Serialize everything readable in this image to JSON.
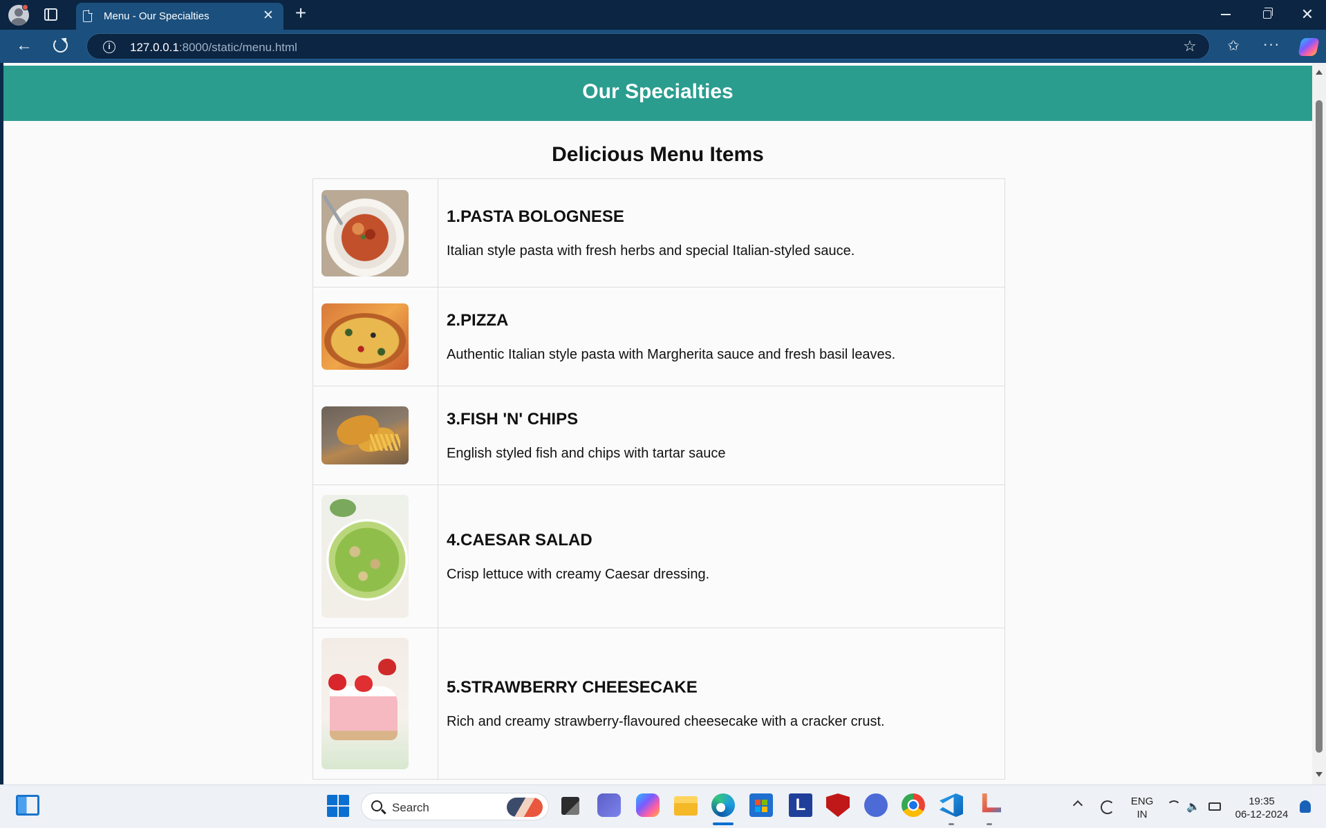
{
  "browser": {
    "tab_title": "Menu - Our Specialties",
    "tab_close": "✕",
    "new_tab": "+",
    "url_host": "127.0.0.1",
    "url_path": ":8000/static/menu.html",
    "window_close": "✕"
  },
  "page": {
    "header_title": "Our Specialties",
    "section_title": "Delicious Menu Items",
    "items": [
      {
        "name": "1.PASTA BOLOGNESE",
        "description": "Italian style pasta with fresh herbs and special Italian-styled sauce.",
        "image": "pasta-bolognese"
      },
      {
        "name": "2.PIZZA",
        "description": "Authentic Italian style pasta with Margherita sauce and fresh basil leaves.",
        "image": "pizza"
      },
      {
        "name": "3.FISH 'N' CHIPS",
        "description": "English styled fish and chips with tartar sauce",
        "image": "fish-and-chips"
      },
      {
        "name": "4.CAESAR SALAD",
        "description": "Crisp lettuce with creamy Caesar dressing.",
        "image": "caesar-salad"
      },
      {
        "name": "5.STRAWBERRY CHEESECAKE",
        "description": "Rich and creamy strawberry-flavoured cheesecake with a cracker crust.",
        "image": "strawberry-cheesecake"
      }
    ]
  },
  "taskbar": {
    "search_text": "Search",
    "language_top": "ENG",
    "language_bottom": "IN",
    "time": "19:35",
    "date": "06-12-2024"
  },
  "colors": {
    "header_bg": "#2a9d8f",
    "browser_chrome": "#1b4f7d",
    "titlebar": "#0b2542"
  },
  "icons": [
    "profile-icon",
    "workspaces-icon",
    "page-icon",
    "back-icon",
    "refresh-icon",
    "info-icon",
    "star-icon",
    "favorites-icon",
    "more-icon",
    "copilot-icon",
    "widgets-icon",
    "start-icon",
    "search-icon",
    "task-view-icon",
    "teams-icon",
    "file-explorer-icon",
    "edge-icon",
    "store-icon",
    "mcafee-icon",
    "chrome-icon",
    "vscode-icon",
    "snipping-tool-icon",
    "wifi-icon",
    "volume-icon",
    "battery-icon",
    "notification-icon"
  ]
}
